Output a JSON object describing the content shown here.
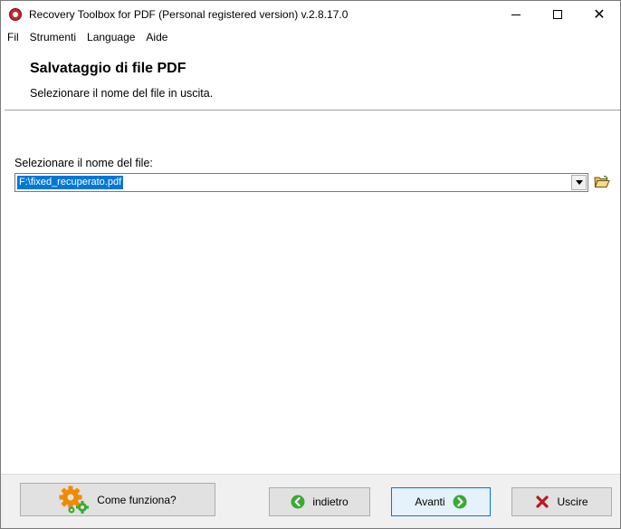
{
  "window": {
    "title": "Recovery Toolbox for PDF (Personal registered version) v.2.8.17.0"
  },
  "menu": {
    "items": [
      {
        "label": "Fil"
      },
      {
        "label": "Strumenti"
      },
      {
        "label": "Language"
      },
      {
        "label": "Aide"
      }
    ]
  },
  "header": {
    "title": "Salvataggio di file PDF",
    "subtitle": "Selezionare il nome del file in uscita."
  },
  "form": {
    "file_label": "Selezionare il nome del file:",
    "file_value": "F:\\fixed_recuperato.pdf"
  },
  "buttons": {
    "how_it_works": "Come funziona?",
    "back": "indietro",
    "next": "Avanti",
    "exit": "Uscire"
  },
  "colors": {
    "selection": "#0078d7",
    "exit_icon": "#c62828",
    "nav_icon": "#3aa935",
    "gear_orange": "#f08a00",
    "gear_green": "#3aa935"
  }
}
